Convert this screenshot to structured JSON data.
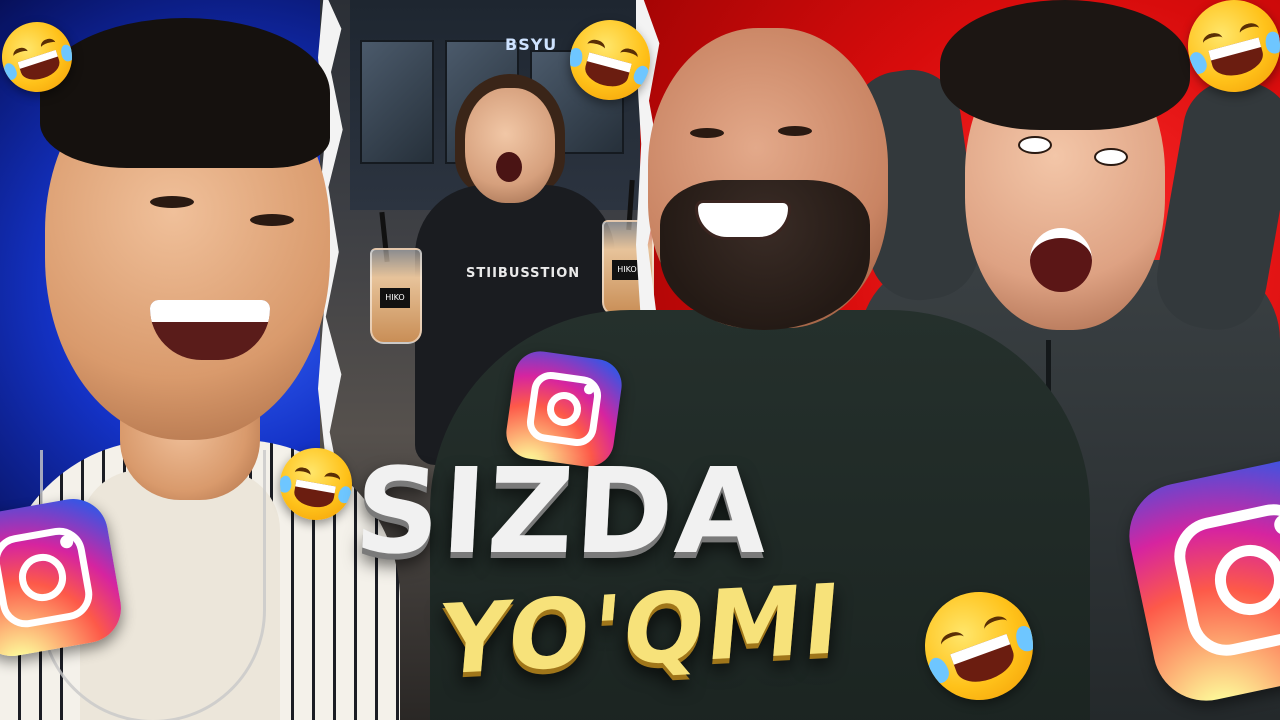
{
  "thumbnail": {
    "title_line1": "SIZDA",
    "title_line2": "YO'QMI",
    "shirt_text": "STIIBUSSTION",
    "cup_label": "HIKO",
    "store_sign": "BSYU"
  },
  "colors": {
    "left_background": "#1433c8",
    "right_background": "#d80c0c",
    "title_main": "#f1f1f1",
    "title_sub": "#f7e27a"
  },
  "icons": {
    "emoji": "rolling-on-the-floor-laughing",
    "logo": "instagram"
  }
}
